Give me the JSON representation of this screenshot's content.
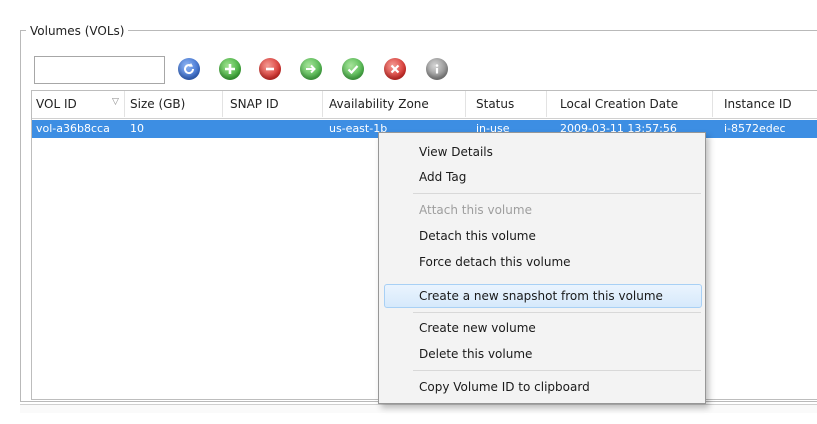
{
  "groupbox": {
    "title": "Volumes (VOLs)"
  },
  "toolbar": {
    "filter_value": "",
    "buttons": [
      {
        "name": "refresh-button",
        "icon": "refresh-icon",
        "color": "#3b6fd1"
      },
      {
        "name": "add-button",
        "icon": "plus-icon",
        "color": "#3fae3a"
      },
      {
        "name": "delete-button",
        "icon": "minus-icon",
        "color": "#d9302c"
      },
      {
        "name": "attach-button",
        "icon": "arrow-icon",
        "color": "#4bb54a"
      },
      {
        "name": "confirm-button",
        "icon": "checkmark-icon",
        "color": "#4bb54a"
      },
      {
        "name": "cancel-button",
        "icon": "x-icon",
        "color": "#d9302c"
      },
      {
        "name": "info-button",
        "icon": "info-icon",
        "color": "#8a8a8a"
      }
    ]
  },
  "table": {
    "columns": [
      "VOL ID",
      "Size (GB)",
      "SNAP ID",
      "Availability Zone",
      "Status",
      "Local Creation Date",
      "Instance ID"
    ],
    "rows": [
      {
        "vol_id": "vol-a36b8cca",
        "size": "10",
        "snap_id": "",
        "zone": "us-east-1b",
        "status": "in-use",
        "created": "2009-03-11 13:57:56",
        "instance": "i-8572edec"
      }
    ],
    "selected_row_color": "#3d8ee3"
  },
  "context_menu": {
    "items": [
      {
        "label": "View Details",
        "enabled": true
      },
      {
        "label": "Add Tag",
        "enabled": true
      },
      {
        "label": "Attach this volume",
        "enabled": false
      },
      {
        "label": "Detach this volume",
        "enabled": true
      },
      {
        "label": "Force detach this volume",
        "enabled": true
      },
      {
        "label": "Create a new snapshot from this volume",
        "enabled": true,
        "highlighted": true
      },
      {
        "label": "Create new volume",
        "enabled": true
      },
      {
        "label": "Delete this volume",
        "enabled": true
      },
      {
        "label": "Copy Volume ID to clipboard",
        "enabled": true
      }
    ]
  }
}
